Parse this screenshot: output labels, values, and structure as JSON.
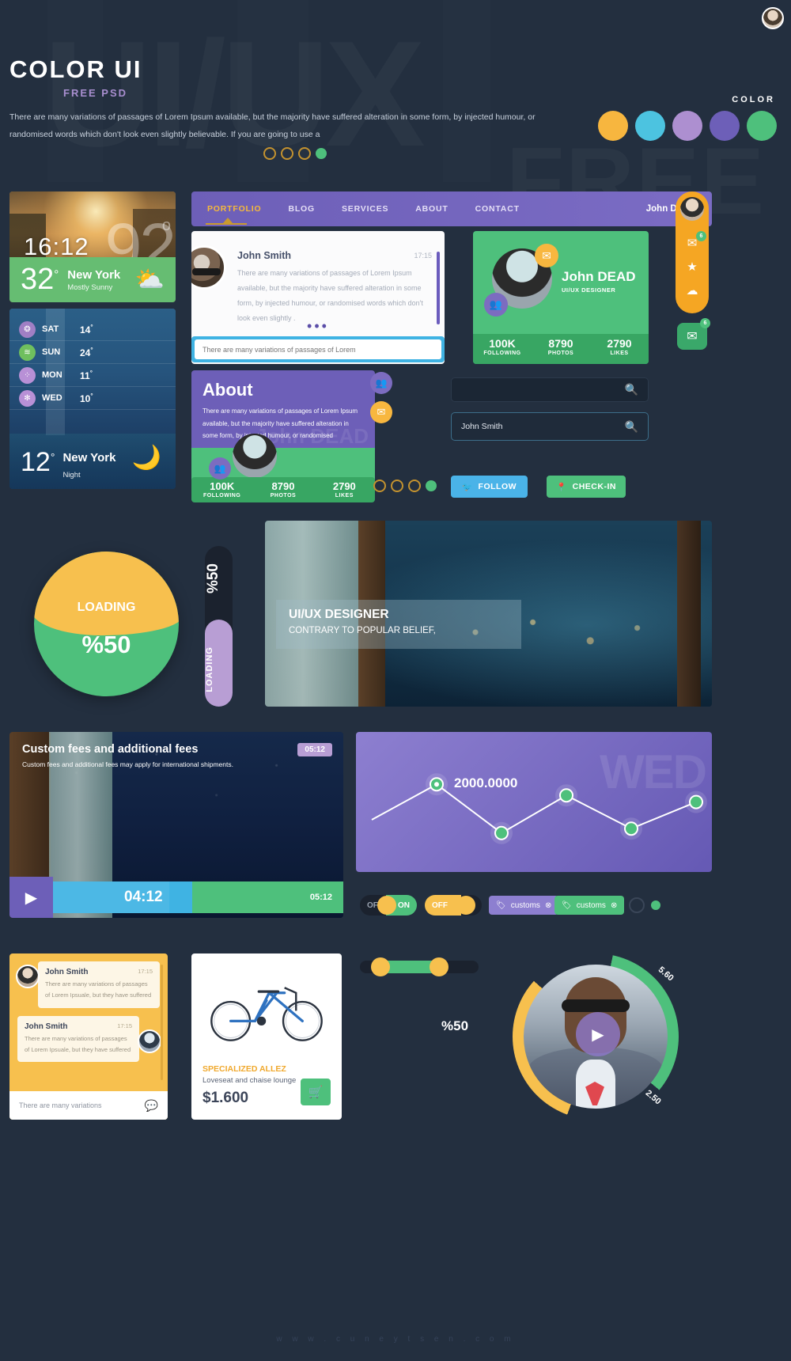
{
  "watermarks": {
    "big": "UI/UX",
    "sub": "FREE"
  },
  "header": {
    "title": "COLOR UI",
    "subtitle": "FREE PSD",
    "intro": "There are many variations of passages of Lorem Ipsum available, but the majority have suffered alteration in some form, by injected humour, or randomised words which don't look even slightly believable. If you are going to use a",
    "color_label": "COLOR",
    "swatches": [
      "#f7b63f",
      "#4cc3e0",
      "#ad8fd0",
      "#6d5fb8",
      "#4ec07c"
    ]
  },
  "weather_now": {
    "time": "16:12",
    "bg_temp": "92",
    "bg_deg": "o",
    "temp": "32",
    "deg": "°",
    "city": "New York",
    "condition": "Mostly Sunny",
    "icon": "sun-cloud-icon"
  },
  "weather_forecast": {
    "rows": [
      {
        "day": "SAT",
        "temp": "14",
        "deg": "°",
        "icon": "snail-icon",
        "color": "#a07fc4"
      },
      {
        "day": "SUN",
        "temp": "24",
        "deg": "°",
        "icon": "rain-icon",
        "color": "#6fbf5e"
      },
      {
        "day": "MON",
        "temp": "11",
        "deg": "°",
        "icon": "hail-icon",
        "color": "#b890d6"
      },
      {
        "day": "WED",
        "temp": "10",
        "deg": "°",
        "icon": "snow-icon",
        "color": "#b890d6"
      }
    ],
    "temp": "12",
    "deg": "°",
    "city": "New York",
    "condition": "Night",
    "icon": "moon-icon"
  },
  "nav": {
    "items": [
      {
        "label": "PORTFOLIO",
        "active": true
      },
      {
        "label": "BLOG",
        "active": false
      },
      {
        "label": "SERVICES",
        "active": false
      },
      {
        "label": "ABOUT",
        "active": false
      },
      {
        "label": "CONTACT",
        "active": false
      }
    ],
    "user": "John DEAD"
  },
  "chat": {
    "name": "John Smith",
    "time": "17:15",
    "message": "There are many variations of passages of Lorem Ipsum available, but the majority have suffered alteration in some form, by injected humour, or randomised words which don't look even slightly .",
    "typing": "•••",
    "input_placeholder": "There are many variations of passages of Lorem",
    "input_value": ""
  },
  "profile": {
    "name": "John DEAD",
    "role": "UI/UX DESIGNER",
    "mail_badge": "mail-icon",
    "users_badge": "users-icon",
    "stats": [
      {
        "value": "100K",
        "label": "FOLLOWING"
      },
      {
        "value": "8790",
        "label": "PHOTOS"
      },
      {
        "value": "2790",
        "label": "LIKES"
      }
    ]
  },
  "rail": {
    "items": [
      {
        "icon": "mail-icon",
        "badge": "6"
      },
      {
        "icon": "star-icon",
        "badge": ""
      },
      {
        "icon": "cloud-icon",
        "badge": ""
      }
    ],
    "chat_icon": "chat-icon",
    "chat_badge": "6"
  },
  "about": {
    "title": "About",
    "text": "There are many variations of passages of Lorem Ipsum available, but the majority have suffered alteration in some form, by injected humour, or randomised",
    "watermark": "John DEAD",
    "stats": [
      {
        "value": "100K",
        "label": "FOLLOWING"
      },
      {
        "value": "8790",
        "label": "PHOTOS"
      },
      {
        "value": "2790",
        "label": "LIKES"
      }
    ]
  },
  "search": {
    "empty_value": "",
    "empty_placeholder": "",
    "filled_value": "John Smith",
    "icon": "search-icon"
  },
  "actions": {
    "follow": "FOLLOW",
    "follow_icon": "twitter-icon",
    "checkin": "CHECK-IN",
    "checkin_icon": "location-pin-icon",
    "dots": [
      "ring",
      "ring",
      "ring",
      "fill"
    ]
  },
  "loading_circle": {
    "label": "LOADING",
    "percent": "%50"
  },
  "loading_vertical": {
    "percent": "%50",
    "label": "LOADING"
  },
  "hero": {
    "title": "UI/UX DESIGNER",
    "subtitle": "CONTRARY TO POPULAR BELIEF,",
    "dots": [
      "ring",
      "ring",
      "ring",
      "fill"
    ]
  },
  "video": {
    "title": "Custom fees and additional fees",
    "subtitle": "Custom fees and additional fees may apply for international shipments.",
    "duration_badge": "05:12",
    "current_time": "04:12",
    "total_time": "05:12",
    "play_icon": "play-icon"
  },
  "chart_data": {
    "type": "line",
    "title": "",
    "watermark": "WED",
    "x": [
      0,
      1,
      2,
      3,
      4,
      5
    ],
    "values": [
      1200,
      2000,
      900,
      1750,
      1000,
      1600
    ],
    "point_label": "2000.0000",
    "labeled_index": 1,
    "ylim": [
      700,
      2200
    ],
    "xlabel": "",
    "ylabel": "",
    "grid": false,
    "legend": "none",
    "line_color": "#ffffff",
    "point_color": "#4ec07c",
    "bg_color": "#7a6cc6"
  },
  "toggles": [
    {
      "off": "OFF",
      "on": "ON",
      "state": "on"
    },
    {
      "off": "OFF",
      "on": "ON",
      "state": "off"
    }
  ],
  "chips": [
    {
      "label": "customs",
      "icon": "tag-icon",
      "close": "close-icon",
      "color": "#8d7fd0"
    },
    {
      "label": "customs",
      "icon": "tag-icon",
      "close": "close-icon",
      "color": "#4ec07c"
    }
  ],
  "slider": {
    "min_value": "",
    "max_value": "",
    "fill_percent": 48
  },
  "messages": {
    "items": [
      {
        "name": "John Smith",
        "time": "17:15",
        "text": "There are many variations of passages of Lorem Ipsuale, but they have suffered",
        "side": "left"
      },
      {
        "name": "John Smith",
        "time": "17:15",
        "text": "There are many variations of passages of Lorem Ipsuale, but they have suffered",
        "side": "right"
      }
    ],
    "footer": "There are many variations",
    "footer_icon": "chat-icon"
  },
  "product": {
    "brand": "SPECIALIZED ALLEZ",
    "name": "Loveseat and chaise lounge",
    "price": "$1.600",
    "cart_icon": "cart-icon"
  },
  "circular_profile": {
    "percent": "%50",
    "top_value": "5.60",
    "bottom_value": "2.50",
    "play_icon": "play-icon"
  },
  "footer": "w w w . c u n e y t s e n . c o m"
}
